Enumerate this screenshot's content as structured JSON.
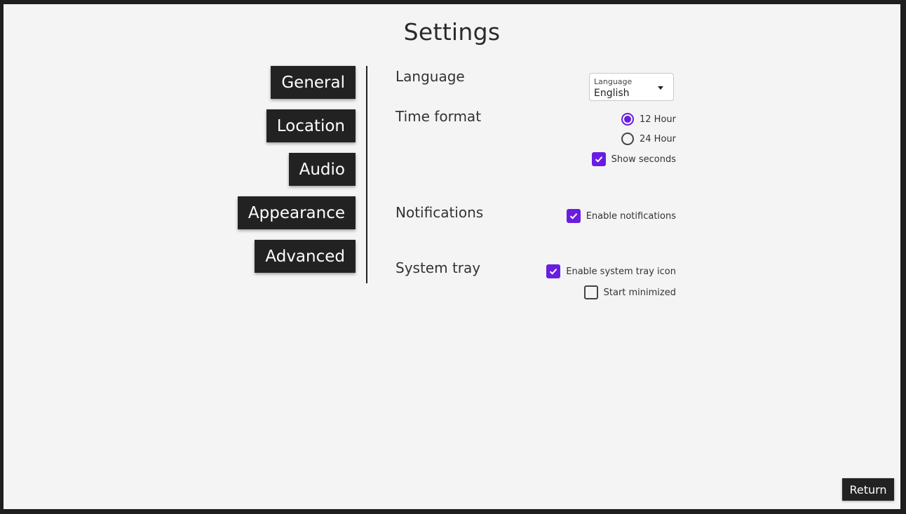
{
  "page": {
    "title": "Settings"
  },
  "nav": {
    "items": [
      {
        "label": "General"
      },
      {
        "label": "Location"
      },
      {
        "label": "Audio"
      },
      {
        "label": "Appearance"
      },
      {
        "label": "Advanced"
      }
    ]
  },
  "language": {
    "label": "Language",
    "select_caption": "Language",
    "selected": "English"
  },
  "time_format": {
    "label": "Time format",
    "options": [
      {
        "label": "12 Hour",
        "checked": true
      },
      {
        "label": "24 Hour",
        "checked": false
      }
    ],
    "show_seconds": {
      "label": "Show seconds",
      "checked": true
    }
  },
  "notifications": {
    "label": "Notifications",
    "enable": {
      "label": "Enable notifications",
      "checked": true
    }
  },
  "system_tray": {
    "label": "System tray",
    "enable_icon": {
      "label": "Enable system tray icon",
      "checked": true
    },
    "start_minimized": {
      "label": "Start minimized",
      "checked": false
    }
  },
  "footer": {
    "return_label": "Return"
  },
  "colors": {
    "accent": "#6a1de0",
    "button_bg": "#222222",
    "panel_bg": "#f4f4f4"
  }
}
